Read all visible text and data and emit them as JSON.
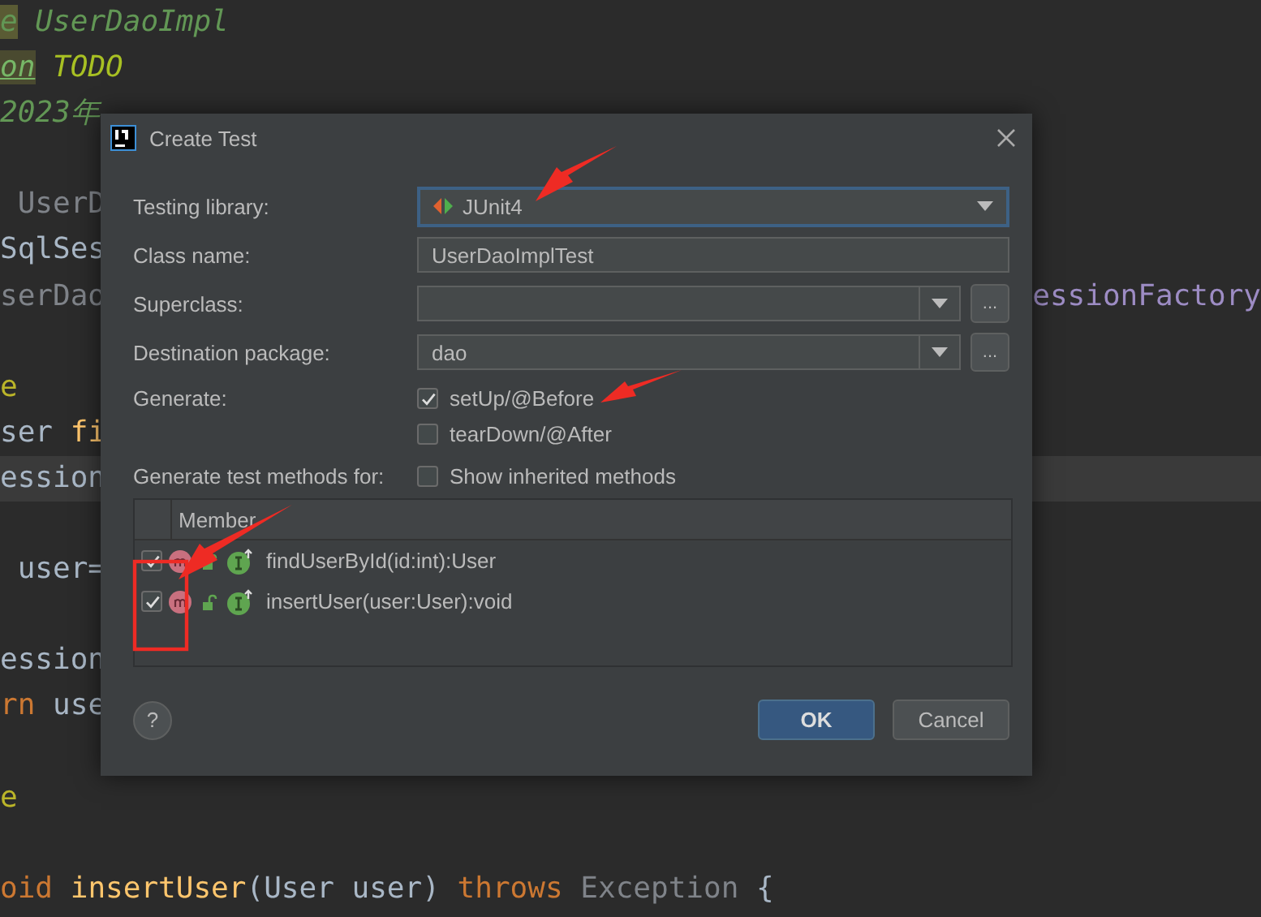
{
  "editor": {
    "lines": [
      {
        "kind": "code",
        "left": [
          {
            "t": "e",
            "kind": "mark"
          },
          {
            "t": " UserDaoImpl",
            "kind": "comment"
          }
        ]
      },
      {
        "kind": "code",
        "left": [
          {
            "t": "on",
            "kind": "tag"
          },
          {
            "t": " TODO",
            "kind": "todo"
          }
        ]
      },
      {
        "kind": "code",
        "left": [
          {
            "t": "2023年",
            "kind": "comment"
          }
        ]
      },
      {
        "kind": "blank"
      },
      {
        "kind": "code",
        "left": [
          {
            "t": " UserD",
            "kind": "muted"
          }
        ]
      },
      {
        "kind": "code",
        "left": [
          {
            "t": "SqlSes",
            "kind": "plain"
          }
        ]
      },
      {
        "kind": "code",
        "left": [
          {
            "t": "serDao",
            "kind": "muted"
          }
        ],
        "right": [
          {
            "t": "essionFactory",
            "kind": "field"
          }
        ]
      },
      {
        "kind": "blank"
      },
      {
        "kind": "code",
        "left": [
          {
            "t": "e",
            "kind": "annotation"
          }
        ]
      },
      {
        "kind": "code",
        "left": [
          {
            "t": "ser ",
            "kind": "plain"
          },
          {
            "t": "fi",
            "kind": "method"
          }
        ]
      },
      {
        "kind": "code",
        "current": true,
        "left": [
          {
            "t": "ession",
            "kind": "plain"
          }
        ]
      },
      {
        "kind": "blank"
      },
      {
        "kind": "code",
        "left": [
          {
            "t": " user=",
            "kind": "plain"
          }
        ]
      },
      {
        "kind": "blank"
      },
      {
        "kind": "code",
        "left": [
          {
            "t": "ession",
            "kind": "plain"
          }
        ]
      },
      {
        "kind": "code",
        "left": [
          {
            "t": "rn",
            "kind": "keyword"
          },
          {
            "t": " use",
            "kind": "plain"
          }
        ]
      },
      {
        "kind": "blank"
      },
      {
        "kind": "code",
        "left": [
          {
            "t": "e",
            "kind": "annotation"
          }
        ]
      },
      {
        "kind": "blank"
      },
      {
        "kind": "code",
        "left": [
          {
            "t": "oid",
            "kind": "keyword"
          },
          {
            "t": " insertUser",
            "kind": "method"
          },
          {
            "t": "(User user) ",
            "kind": "plain"
          },
          {
            "t": "throws",
            "kind": "keyword"
          },
          {
            "t": " Exception",
            "kind": "muted"
          },
          {
            "t": " {",
            "kind": "plain"
          }
        ]
      }
    ]
  },
  "dialog": {
    "title": "Create Test",
    "fields": [
      {
        "kind": "library",
        "label": "Testing library:",
        "value": "JUnit4",
        "focused": true
      },
      {
        "kind": "text",
        "label": "Class name:",
        "value": "UserDaoImplTest"
      },
      {
        "kind": "browse",
        "label": "Superclass:",
        "browse": "..."
      },
      {
        "kind": "browse",
        "label": "Destination package:",
        "value": "dao",
        "browse": "..."
      }
    ],
    "generate": {
      "label": "Generate:",
      "options": [
        {
          "label": "setUp/@Before",
          "checked": true
        },
        {
          "label": "tearDown/@After",
          "checked": false
        }
      ]
    },
    "methods": {
      "label": "Generate test methods for:",
      "show_inherited": {
        "label": "Show inherited methods",
        "checked": false
      },
      "column": "Member",
      "rows": [
        {
          "signature": "findUserById(id:int):User",
          "checked": true
        },
        {
          "signature": "insertUser(user:User):void",
          "checked": true
        }
      ]
    },
    "buttons": {
      "help": "?",
      "ok": "OK",
      "cancel": "Cancel"
    }
  }
}
